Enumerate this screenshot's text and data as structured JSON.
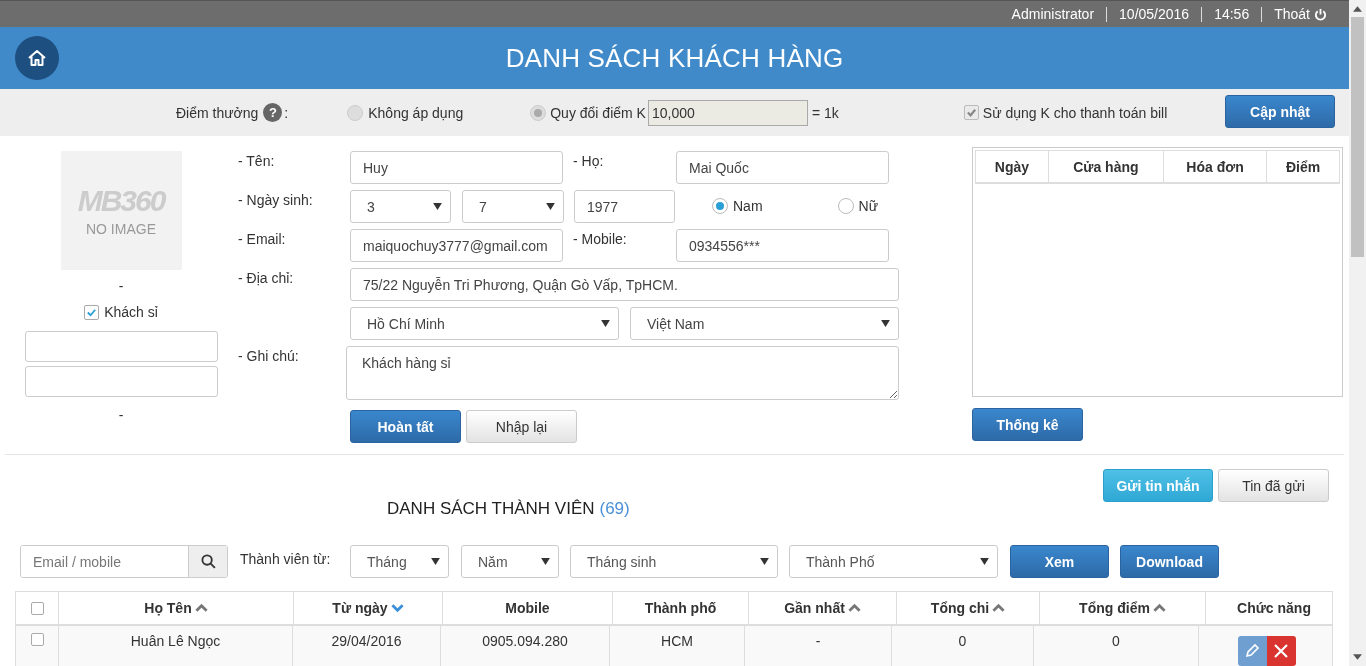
{
  "top_bar": {
    "user": "Administrator",
    "date": "10/05/2016",
    "time": "14:56",
    "logout": "Thoát"
  },
  "header": {
    "title": "DANH SÁCH KHÁCH HÀNG"
  },
  "bonus_settings": {
    "label": "Điểm thưởng",
    "help": "?",
    "label_suffix": ":",
    "disabled": true,
    "options": [
      {
        "label": "Không áp dụng",
        "selected": false
      },
      {
        "label": "Quy đổi điểm K",
        "selected": true
      }
    ],
    "rate_value": "10,000",
    "rate_unit": "= 1k",
    "use_k": {
      "label": "Sử dụng K cho thanh toán bill",
      "checked": true
    },
    "update_button": "Cập nhật"
  },
  "customer": {
    "avatar": {
      "logo": "MB360",
      "caption": "NO IMAGE"
    },
    "code": "-",
    "wholesale": {
      "label": "Khách sỉ",
      "checked": true
    },
    "footer": "-"
  },
  "form": {
    "first_name": {
      "label": "- Tên:",
      "value": "Huy"
    },
    "last_name": {
      "label": "- Họ:",
      "value": "Mai Quốc"
    },
    "birthday": {
      "label": "- Ngày sinh:",
      "day": "3",
      "month": "7",
      "year": "1977"
    },
    "gender": [
      {
        "label": "Nam",
        "selected": true
      },
      {
        "label": "Nữ",
        "selected": false
      }
    ],
    "email": {
      "label": "- Email:",
      "value": "maiquochuy3777@gmail.com"
    },
    "mobile": {
      "label": "- Mobile:",
      "value": "0934556***"
    },
    "address": {
      "label": "- Địa chỉ:",
      "value": "75/22 Nguyễn Tri Phương, Quận Gò Vấp, TpHCM.",
      "city": "Hồ Chí Minh",
      "country": "Việt Nam"
    },
    "note": {
      "label": "- Ghi chú:",
      "value": "Khách hàng sỉ"
    },
    "submit_button": "Hoàn tất",
    "reset_button": "Nhập lại"
  },
  "history": {
    "columns": [
      "Ngày",
      "Cửa hàng",
      "Hóa đơn",
      "Điểm"
    ],
    "stats_button": "Thống kê"
  },
  "members": {
    "send_button": "Gửi tin nhắn",
    "sent_button": "Tin đã gửi",
    "title": "DANH SÁCH THÀNH VIÊN",
    "count": "(69)",
    "search": {
      "placeholder": "Email / mobile"
    },
    "filter_label": "Thành viên từ:",
    "filters": [
      "Tháng",
      "Năm",
      "Tháng sinh",
      "Thành Phố"
    ],
    "view_button": "Xem",
    "download_button": "Download",
    "table": {
      "select_all": false,
      "columns": [
        {
          "label": "Họ Tên",
          "sort_up": true,
          "sort_down": false
        },
        {
          "label": "Từ ngày",
          "sort_up": false,
          "sort_down": true
        },
        {
          "label": "Mobile",
          "sort_up": false,
          "sort_down": false
        },
        {
          "label": "Thành phố",
          "sort_up": false,
          "sort_down": false
        },
        {
          "label": "Gần nhất",
          "sort_up": true,
          "sort_down": false
        },
        {
          "label": "Tổng chi",
          "sort_up": true,
          "sort_down": false
        },
        {
          "label": "Tổng điểm",
          "sort_up": true,
          "sort_down": false
        },
        {
          "label": "Chức năng",
          "sort_up": false,
          "sort_down": false
        }
      ],
      "rows": [
        {
          "selected": false,
          "cells": [
            "Huân Lê Ngọc",
            "29/04/2016",
            "0905.094.280",
            "HCM",
            "-",
            "0",
            "0"
          ]
        }
      ]
    }
  }
}
